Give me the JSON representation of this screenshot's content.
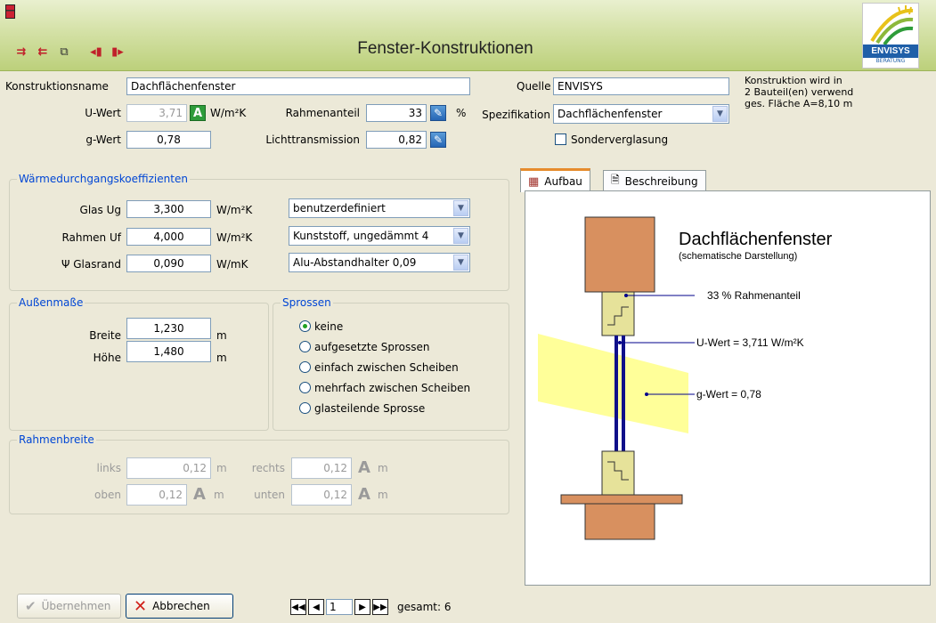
{
  "window": {
    "title": "Fenster-Konstruktionen"
  },
  "logo": {
    "text": "ENVISYS",
    "tagline": [
      "BERATUNG",
      "ENERGIE",
      "SOFTWARE"
    ]
  },
  "toolbar": {
    "icons": [
      "add-icon",
      "remove-icon",
      "copy-icon",
      "import-icon",
      "export-icon"
    ]
  },
  "form": {
    "konstruktionsname_label": "Konstruktionsname",
    "konstruktionsname_value": "Dachflächenfenster",
    "uwert_label": "U-Wert",
    "uwert_value": "3,71",
    "uwert_unit": "W/m²K",
    "gwert_label": "g-Wert",
    "gwert_value": "0,78",
    "rahmenanteil_label": "Rahmenanteil",
    "rahmenanteil_value": "33",
    "rahmenanteil_unit": "%",
    "licht_label": "Lichttransmission",
    "licht_value": "0,82",
    "quelle_label": "Quelle",
    "quelle_value": "ENVISYS",
    "spezifikation_label": "Spezifikation",
    "spezifikation_value": "Dachflächenfenster",
    "sonder_label": "Sonderverglasung",
    "info_line1": "Konstruktion wird in",
    "info_line2": "2 Bauteil(en) verwend",
    "info_line3": "ges. Fläche A=8,10 m"
  },
  "waerme": {
    "title": "Wärmedurchgangskoeffizienten",
    "rows": [
      {
        "label": "Glas Ug",
        "value": "3,300",
        "unit": "W/m²K",
        "option": "benutzerdefiniert"
      },
      {
        "label": "Rahmen Uf",
        "value": "4,000",
        "unit": "W/m²K",
        "option": "Kunststoff, ungedämmt 4"
      },
      {
        "label": "Ψ Glasrand",
        "value": "0,090",
        "unit": "W/mK",
        "option": "Alu-Abstandhalter 0,09"
      }
    ]
  },
  "aussen": {
    "title": "Außenmaße",
    "breite_label": "Breite",
    "breite_value": "1,230",
    "breite_unit": "m",
    "hoehe_label": "Höhe",
    "hoehe_value": "1,480",
    "hoehe_unit": "m"
  },
  "sprossen": {
    "title": "Sprossen",
    "options": [
      "keine",
      "aufgesetzte Sprossen",
      "einfach zwischen Scheiben",
      "mehrfach zwischen Scheiben",
      "glasteilende Sprosse"
    ],
    "selected": "keine"
  },
  "rahmenbreite": {
    "title": "Rahmenbreite",
    "links_label": "links",
    "links_value": "0,12",
    "rechts_label": "rechts",
    "rechts_value": "0,12",
    "oben_label": "oben",
    "oben_value": "0,12",
    "unten_label": "unten",
    "unten_value": "0,12",
    "unit": "m"
  },
  "tabs": {
    "aufbau": "Aufbau",
    "beschreibung": "Beschreibung"
  },
  "diagram": {
    "title": "Dachflächenfenster",
    "subtitle": "(schematische Darstellung)",
    "ann_rahmen": "33 % Rahmenanteil",
    "ann_uwert": "U-Wert = 3,711 W/m²K",
    "ann_gwert": "g-Wert = 0,78"
  },
  "footer": {
    "uebernehmen": "Übernehmen",
    "abbrechen": "Abbrechen",
    "page": "1",
    "gesamt": "gesamt: 6"
  },
  "colors": {
    "accent": "#0046d5",
    "green_badge": "#2e9c3a",
    "tab_accent": "#e68b2c"
  }
}
